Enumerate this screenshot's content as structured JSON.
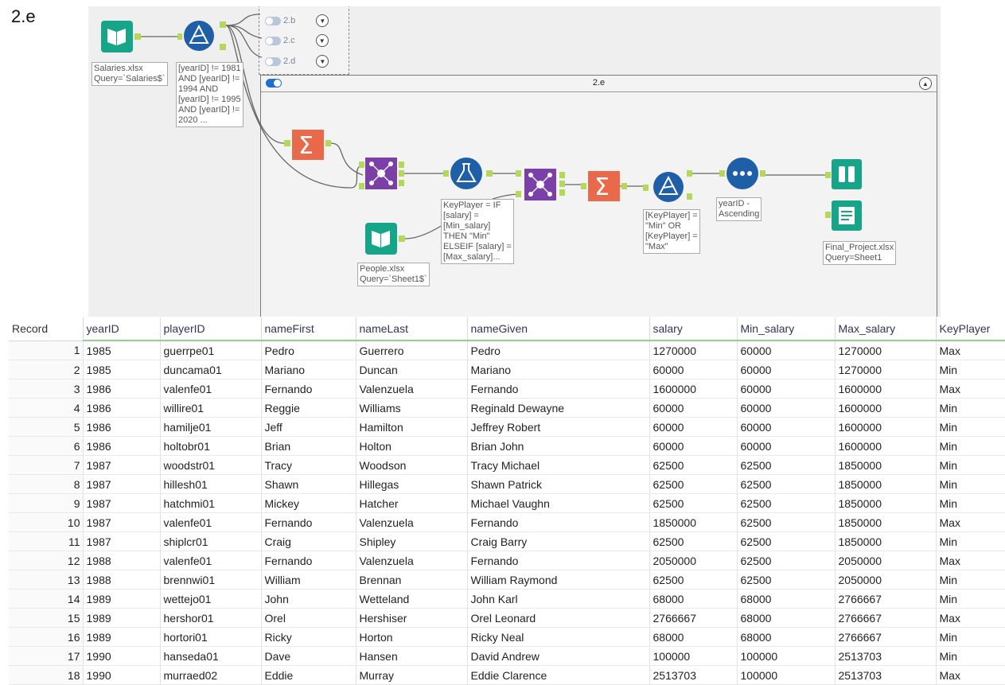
{
  "page_label": "2.e",
  "workflow": {
    "collapsed_containers": [
      {
        "label": "2.b"
      },
      {
        "label": "2.c"
      },
      {
        "label": "2.d"
      }
    ],
    "container": {
      "title": "2.e"
    },
    "tools": {
      "input_salaries": {
        "icon": "book-icon",
        "color": "#17a589"
      },
      "filter_1": {
        "icon": "triangle-filter-icon",
        "color": "#1f5fa8"
      },
      "summarize_1": {
        "icon": "sigma-icon",
        "color": "#e86a4a"
      },
      "join_1": {
        "icon": "join-icon",
        "color": "#7b3fa8"
      },
      "formula": {
        "icon": "flask-icon",
        "color": "#1f5fa8"
      },
      "input_people": {
        "icon": "book-icon",
        "color": "#17a589"
      },
      "join_2": {
        "icon": "join-icon",
        "color": "#7b3fa8"
      },
      "summarize_2": {
        "icon": "sigma-icon",
        "color": "#e86a4a"
      },
      "filter_2": {
        "icon": "triangle-filter-icon",
        "color": "#1f5fa8"
      },
      "sort": {
        "icon": "dots-icon",
        "color": "#1f5fa8"
      },
      "browse": {
        "icon": "binoculars-icon",
        "color": "#17a589"
      },
      "output": {
        "icon": "output-book-icon",
        "color": "#17a589"
      }
    },
    "annotations": {
      "salaries": "Salaries.xlsx\nQuery=`Salaries$`",
      "filter_1": "[yearID] != 1981\nAND [yearID] !=\n1994 AND\n[yearID] != 1995\nAND [yearID] !=\n2020 ...",
      "formula": "KeyPlayer = IF\n[salary] =\n[Min_salary]\nTHEN \"Min\"\nELSEIF [salary] =\n[Max_salary]...",
      "people": "People.xlsx\nQuery=`Sheet1$`",
      "filter_2": "[KeyPlayer] =\n\"Min\" OR\n[KeyPlayer] =\n\"Max\"",
      "sort": "yearID -\nAscending",
      "output": "Final_Project.xlsx\nQuery=Sheet1"
    }
  },
  "results": {
    "columns": [
      "Record",
      "yearID",
      "playerID",
      "nameFirst",
      "nameLast",
      "nameGiven",
      "salary",
      "Min_salary",
      "Max_salary",
      "KeyPlayer"
    ],
    "rows": [
      [
        "1",
        "1985",
        "guerrpe01",
        "Pedro",
        "Guerrero",
        "Pedro",
        "1270000",
        "60000",
        "1270000",
        "Max"
      ],
      [
        "2",
        "1985",
        "duncama01",
        "Mariano",
        "Duncan",
        "Mariano",
        "60000",
        "60000",
        "1270000",
        "Min"
      ],
      [
        "3",
        "1986",
        "valenfe01",
        "Fernando",
        "Valenzuela",
        "Fernando",
        "1600000",
        "60000",
        "1600000",
        "Max"
      ],
      [
        "4",
        "1986",
        "willire01",
        "Reggie",
        "Williams",
        "Reginald Dewayne",
        "60000",
        "60000",
        "1600000",
        "Min"
      ],
      [
        "5",
        "1986",
        "hamilje01",
        "Jeff",
        "Hamilton",
        "Jeffrey Robert",
        "60000",
        "60000",
        "1600000",
        "Min"
      ],
      [
        "6",
        "1986",
        "holtobr01",
        "Brian",
        "Holton",
        "Brian John",
        "60000",
        "60000",
        "1600000",
        "Min"
      ],
      [
        "7",
        "1987",
        "woodstr01",
        "Tracy",
        "Woodson",
        "Tracy Michael",
        "62500",
        "62500",
        "1850000",
        "Min"
      ],
      [
        "8",
        "1987",
        "hillesh01",
        "Shawn",
        "Hillegas",
        "Shawn Patrick",
        "62500",
        "62500",
        "1850000",
        "Min"
      ],
      [
        "9",
        "1987",
        "hatchmi01",
        "Mickey",
        "Hatcher",
        "Michael Vaughn",
        "62500",
        "62500",
        "1850000",
        "Min"
      ],
      [
        "10",
        "1987",
        "valenfe01",
        "Fernando",
        "Valenzuela",
        "Fernando",
        "1850000",
        "62500",
        "1850000",
        "Max"
      ],
      [
        "11",
        "1987",
        "shiplcr01",
        "Craig",
        "Shipley",
        "Craig Barry",
        "62500",
        "62500",
        "1850000",
        "Min"
      ],
      [
        "12",
        "1988",
        "valenfe01",
        "Fernando",
        "Valenzuela",
        "Fernando",
        "2050000",
        "62500",
        "2050000",
        "Max"
      ],
      [
        "13",
        "1988",
        "brennwi01",
        "William",
        "Brennan",
        "William Raymond",
        "62500",
        "62500",
        "2050000",
        "Min"
      ],
      [
        "14",
        "1989",
        "wettejo01",
        "John",
        "Wetteland",
        "John Karl",
        "68000",
        "68000",
        "2766667",
        "Min"
      ],
      [
        "15",
        "1989",
        "hershor01",
        "Orel",
        "Hershiser",
        "Orel Leonard",
        "2766667",
        "68000",
        "2766667",
        "Max"
      ],
      [
        "16",
        "1989",
        "hortori01",
        "Ricky",
        "Horton",
        "Ricky Neal",
        "68000",
        "68000",
        "2766667",
        "Min"
      ],
      [
        "17",
        "1990",
        "hanseda01",
        "Dave",
        "Hansen",
        "David Andrew",
        "100000",
        "100000",
        "2513703",
        "Min"
      ],
      [
        "18",
        "1990",
        "murraed02",
        "Eddie",
        "Murray",
        "Eddie Clarence",
        "2513703",
        "100000",
        "2513703",
        "Max"
      ]
    ]
  }
}
